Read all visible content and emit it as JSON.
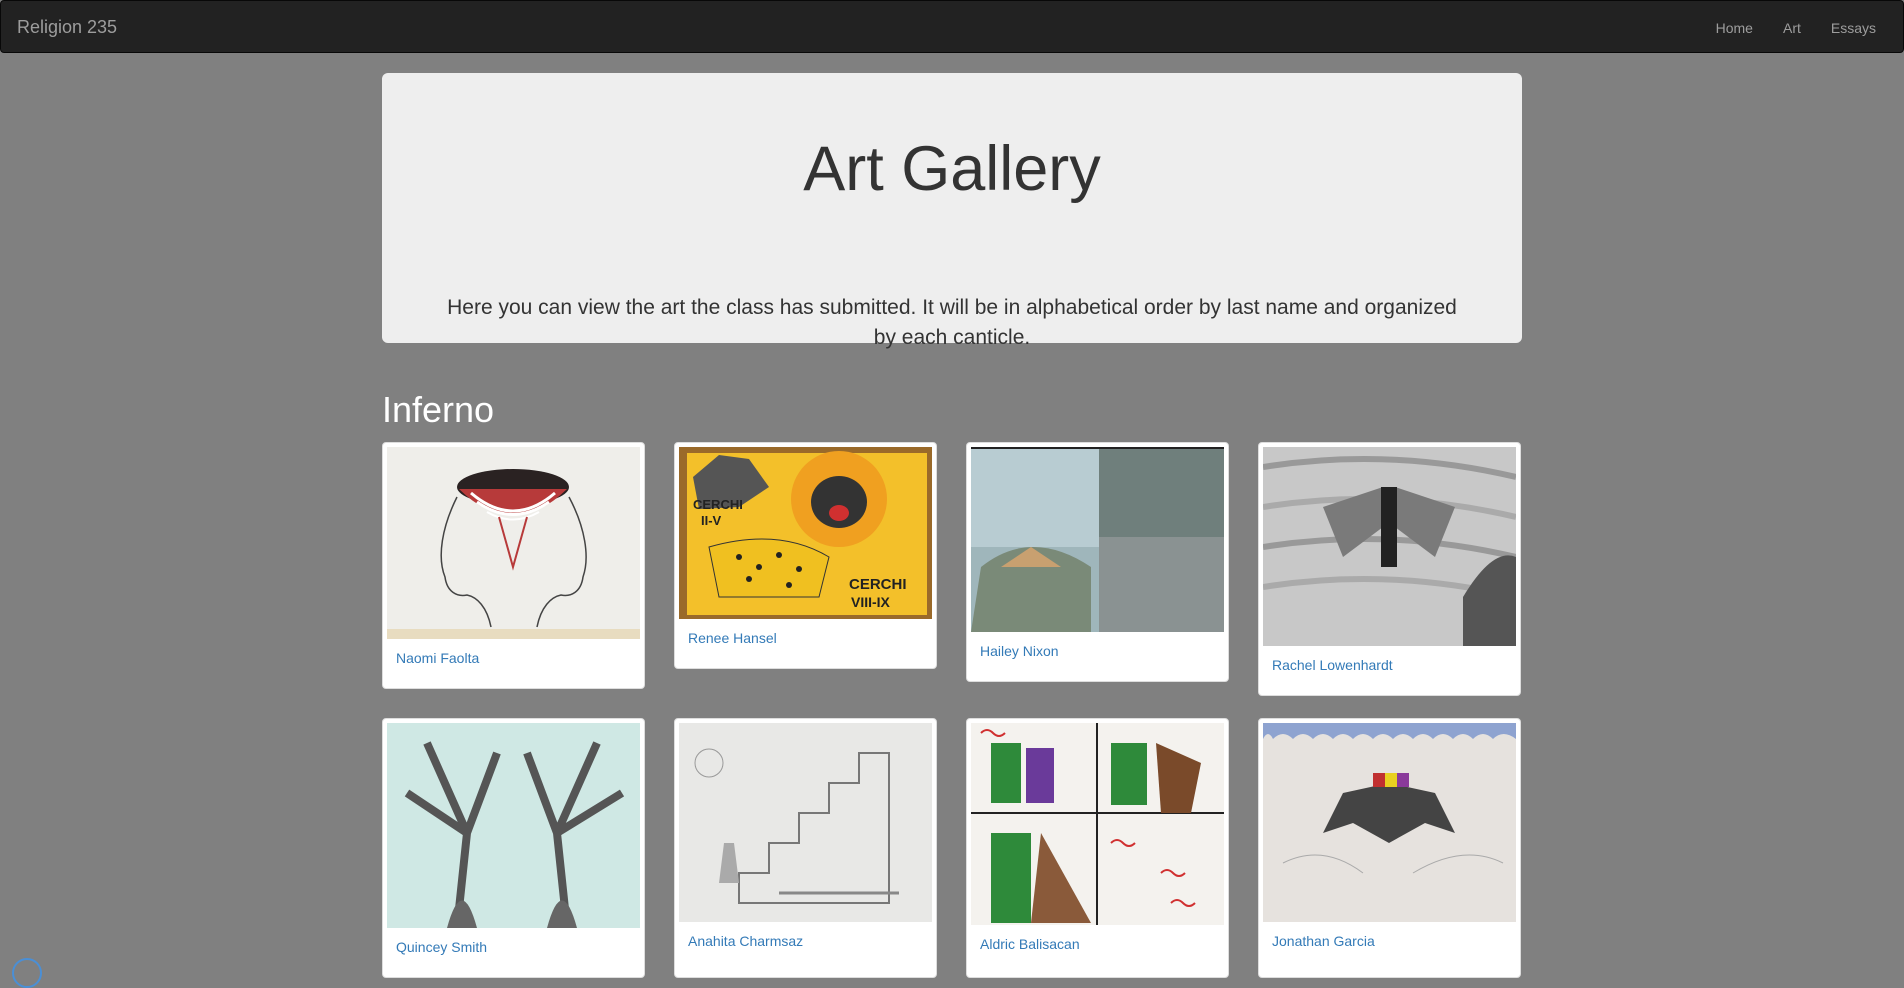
{
  "navbar": {
    "brand": "Religion 235",
    "links": [
      "Home",
      "Art",
      "Essays"
    ]
  },
  "jumbotron": {
    "title": "Art Gallery",
    "text": "Here you can view the art the class has submitted. It will be in alphabetical order by last name and organized by each canticle."
  },
  "section": {
    "title": "Inferno"
  },
  "gallery": [
    {
      "name": "Naomi Faolta",
      "icon": "two-faces-drawing"
    },
    {
      "name": "Renee Hansel",
      "icon": "three-beasts-painting"
    },
    {
      "name": "Hailey Nixon",
      "icon": "landscape-collage"
    },
    {
      "name": "Rachel Lowenhardt",
      "icon": "winged-figure-drawing"
    },
    {
      "name": "Quincey Smith",
      "icon": "two-trees-drawing"
    },
    {
      "name": "Anahita Charmsaz",
      "icon": "stairway-drawing"
    },
    {
      "name": "Aldric Balisacan",
      "icon": "comic-panels-drawing"
    },
    {
      "name": "Jonathan Garcia",
      "icon": "lucifer-drawing"
    }
  ],
  "colors": {
    "background": "#808080",
    "navbar": "#222222",
    "link": "#337ab7"
  }
}
